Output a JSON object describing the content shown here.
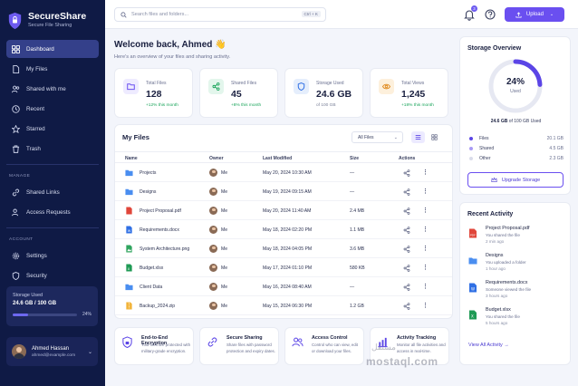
{
  "app": {
    "title": "SecureShare",
    "subtitle": "Secure File Sharing"
  },
  "sidebar": {
    "items": [
      {
        "label": "Dashboard",
        "icon": "grid-icon",
        "active": true
      },
      {
        "label": "My Files",
        "icon": "file-icon"
      },
      {
        "label": "Shared with me",
        "icon": "users-icon"
      },
      {
        "label": "Recent",
        "icon": "clock-icon"
      },
      {
        "label": "Starred",
        "icon": "star-icon"
      },
      {
        "label": "Trash",
        "icon": "trash-icon"
      }
    ],
    "manage_label": "MANAGE",
    "manage_items": [
      {
        "label": "Shared Links",
        "icon": "link-icon"
      },
      {
        "label": "Access Requests",
        "icon": "user-check-icon"
      }
    ],
    "account_label": "ACCOUNT",
    "account_items": [
      {
        "label": "Settings",
        "icon": "gear-icon"
      },
      {
        "label": "Security",
        "icon": "shield-icon"
      }
    ],
    "storage": {
      "label": "Storage Used",
      "value": "24.6 GB / 100 GB",
      "percent": "24%",
      "fraction": 0.24
    },
    "user": {
      "name": "Ahmed Hassan",
      "email": "ahmed@example.com"
    }
  },
  "topbar": {
    "search_placeholder": "Search files and folders...",
    "shortcut": "Ctrl + K",
    "notifications": "3",
    "upload_label": "Upload"
  },
  "welcome": {
    "title": "Welcome back, Ahmed 👋",
    "subtitle": "Here's an overview of your files and sharing activity."
  },
  "stats": [
    {
      "label": "Total Files",
      "value": "128",
      "sub": "+12% this month",
      "color": "#6a4ff0",
      "bg": "#eeebff"
    },
    {
      "label": "Shared Files",
      "value": "45",
      "sub": "+8% this month",
      "color": "#19a45a",
      "bg": "#e3f6ec"
    },
    {
      "label": "Storage Used",
      "value": "24.6 GB",
      "sub": "of 100 GB",
      "color": "#2f6fe4",
      "bg": "#e5eefc"
    },
    {
      "label": "Total Views",
      "value": "1,245",
      "sub": "+18% this month",
      "color": "#e08a1e",
      "bg": "#fdf0dc"
    }
  ],
  "files": {
    "title": "My Files",
    "filter": "All Files",
    "columns": [
      "Name",
      "Owner",
      "Last Modified",
      "Size",
      "Actions"
    ],
    "rows": [
      {
        "name": "Projects",
        "type": "folder",
        "owner": "Me",
        "modified": "May 20, 2024 10:30 AM",
        "size": "—"
      },
      {
        "name": "Designs",
        "type": "folder",
        "owner": "Me",
        "modified": "May 19, 2024 09:15 AM",
        "size": "—"
      },
      {
        "name": "Project Proposal.pdf",
        "type": "pdf",
        "owner": "Me",
        "modified": "May 20, 2024 11:40 AM",
        "size": "2.4 MB"
      },
      {
        "name": "Requirements.docx",
        "type": "doc",
        "owner": "Me",
        "modified": "May 18, 2024 02:20 PM",
        "size": "1.1 MB"
      },
      {
        "name": "System Architecture.png",
        "type": "img",
        "owner": "Me",
        "modified": "May 18, 2024 04:05 PM",
        "size": "3.6 MB"
      },
      {
        "name": "Budget.xlsx",
        "type": "xls",
        "owner": "Me",
        "modified": "May 17, 2024 01:10 PM",
        "size": "580 KB"
      },
      {
        "name": "Client Data",
        "type": "folder",
        "owner": "Me",
        "modified": "May 16, 2024 08:40 AM",
        "size": "—"
      },
      {
        "name": "Backup_2024.zip",
        "type": "zip",
        "owner": "Me",
        "modified": "May 15, 2024 06:30 PM",
        "size": "1.2 GB"
      }
    ]
  },
  "features": [
    {
      "title": "End-to-End Encryption",
      "desc": "Your files are protected with military-grade encryption.",
      "icon": "lock-icon"
    },
    {
      "title": "Secure Sharing",
      "desc": "Share files with password protection and expiry dates.",
      "icon": "link-icon"
    },
    {
      "title": "Access Control",
      "desc": "Control who can view, edit or download your files.",
      "icon": "users-icon"
    },
    {
      "title": "Activity Tracking",
      "desc": "Monitor all file activities and access in real-time.",
      "icon": "chart-icon"
    }
  ],
  "storage_overview": {
    "title": "Storage Overview",
    "percent": "24%",
    "used_label": "Used",
    "used_bold": "24.6 GB",
    "used_rest": " of 100 GB Used",
    "fraction": 0.24,
    "legend": [
      {
        "label": "Files",
        "value": "20.1 GB",
        "color": "#5b45e6"
      },
      {
        "label": "Shared",
        "value": "4.5 GB",
        "color": "#a99bf5"
      },
      {
        "label": "Other",
        "value": "2.3 GB",
        "color": "#d9dcea"
      }
    ],
    "upgrade_label": "Upgrade Storage"
  },
  "recent_activity": {
    "title": "Recent Activity",
    "items": [
      {
        "file": "Project Proposal.pdf",
        "desc": "You shared the file",
        "time": "2 min ago",
        "type": "pdf"
      },
      {
        "file": "Designs",
        "desc": "You uploaded a folder",
        "time": "1 hour ago",
        "type": "folder"
      },
      {
        "file": "Requirements.docx",
        "desc": "Someone viewed the file",
        "time": "3 hours ago",
        "type": "doc"
      },
      {
        "file": "Budget.xlsx",
        "desc": "You shared the file",
        "time": "5 hours ago",
        "type": "xls"
      }
    ],
    "view_all": "View All Activity →"
  },
  "watermark": {
    "arabic": "مستقل",
    "latin": "mostaql.com"
  }
}
